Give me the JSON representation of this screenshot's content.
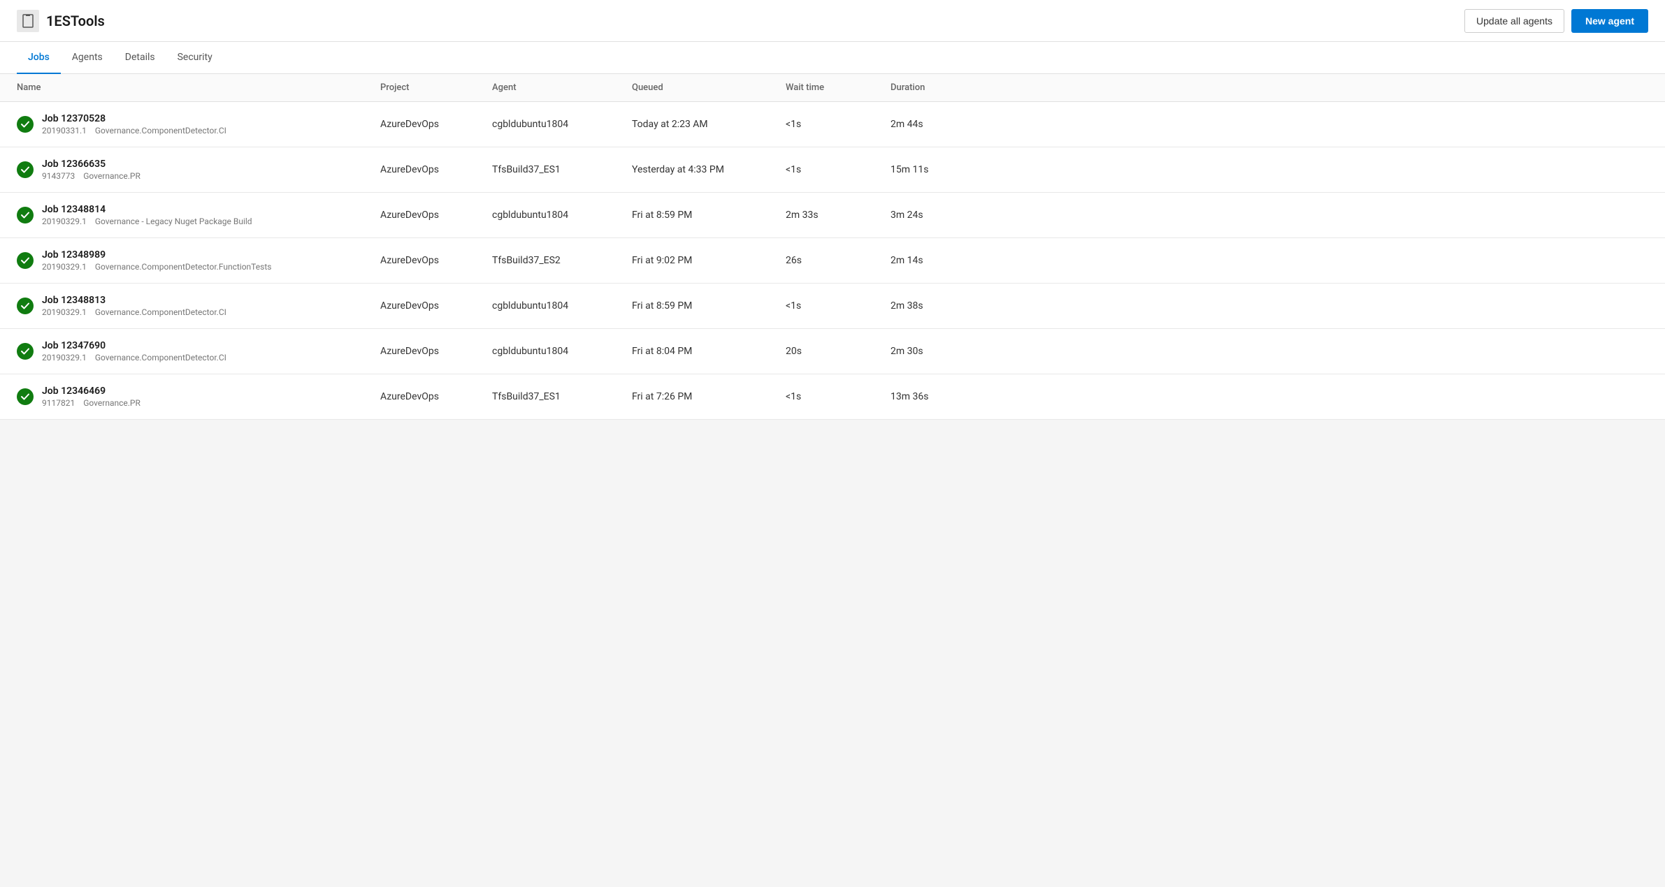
{
  "header": {
    "logo_icon": "📱",
    "title": "1ESTools",
    "update_all_agents_label": "Update all agents",
    "new_agent_label": "New agent"
  },
  "nav": {
    "tabs": [
      {
        "id": "jobs",
        "label": "Jobs",
        "active": true
      },
      {
        "id": "agents",
        "label": "Agents",
        "active": false
      },
      {
        "id": "details",
        "label": "Details",
        "active": false
      },
      {
        "id": "security",
        "label": "Security",
        "active": false
      }
    ]
  },
  "table": {
    "columns": [
      {
        "id": "name",
        "label": "Name"
      },
      {
        "id": "project",
        "label": "Project"
      },
      {
        "id": "agent",
        "label": "Agent"
      },
      {
        "id": "queued",
        "label": "Queued"
      },
      {
        "id": "wait_time",
        "label": "Wait time"
      },
      {
        "id": "duration",
        "label": "Duration"
      }
    ],
    "rows": [
      {
        "status": "success",
        "job_name": "Job 12370528",
        "job_id": "20190331.1",
        "job_pipeline": "Governance.ComponentDetector.CI",
        "project": "AzureDevOps",
        "agent": "cgbldubuntu1804",
        "queued": "Today at 2:23 AM",
        "wait_time": "<1s",
        "duration": "2m 44s"
      },
      {
        "status": "success",
        "job_name": "Job 12366635",
        "job_id": "9143773",
        "job_pipeline": "Governance.PR",
        "project": "AzureDevOps",
        "agent": "TfsBuild37_ES1",
        "queued": "Yesterday at 4:33 PM",
        "wait_time": "<1s",
        "duration": "15m 11s"
      },
      {
        "status": "success",
        "job_name": "Job 12348814",
        "job_id": "20190329.1",
        "job_pipeline": "Governance - Legacy Nuget Package Build",
        "project": "AzureDevOps",
        "agent": "cgbldubuntu1804",
        "queued": "Fri at 8:59 PM",
        "wait_time": "2m 33s",
        "duration": "3m 24s"
      },
      {
        "status": "success",
        "job_name": "Job 12348989",
        "job_id": "20190329.1",
        "job_pipeline": "Governance.ComponentDetector.FunctionTests",
        "project": "AzureDevOps",
        "agent": "TfsBuild37_ES2",
        "queued": "Fri at 9:02 PM",
        "wait_time": "26s",
        "duration": "2m 14s"
      },
      {
        "status": "success",
        "job_name": "Job 12348813",
        "job_id": "20190329.1",
        "job_pipeline": "Governance.ComponentDetector.CI",
        "project": "AzureDevOps",
        "agent": "cgbldubuntu1804",
        "queued": "Fri at 8:59 PM",
        "wait_time": "<1s",
        "duration": "2m 38s"
      },
      {
        "status": "success",
        "job_name": "Job 12347690",
        "job_id": "20190329.1",
        "job_pipeline": "Governance.ComponentDetector.CI",
        "project": "AzureDevOps",
        "agent": "cgbldubuntu1804",
        "queued": "Fri at 8:04 PM",
        "wait_time": "20s",
        "duration": "2m 30s"
      },
      {
        "status": "success",
        "job_name": "Job 12346469",
        "job_id": "9117821",
        "job_pipeline": "Governance.PR",
        "project": "AzureDevOps",
        "agent": "TfsBuild37_ES1",
        "queued": "Fri at 7:26 PM",
        "wait_time": "<1s",
        "duration": "13m 36s"
      }
    ]
  }
}
